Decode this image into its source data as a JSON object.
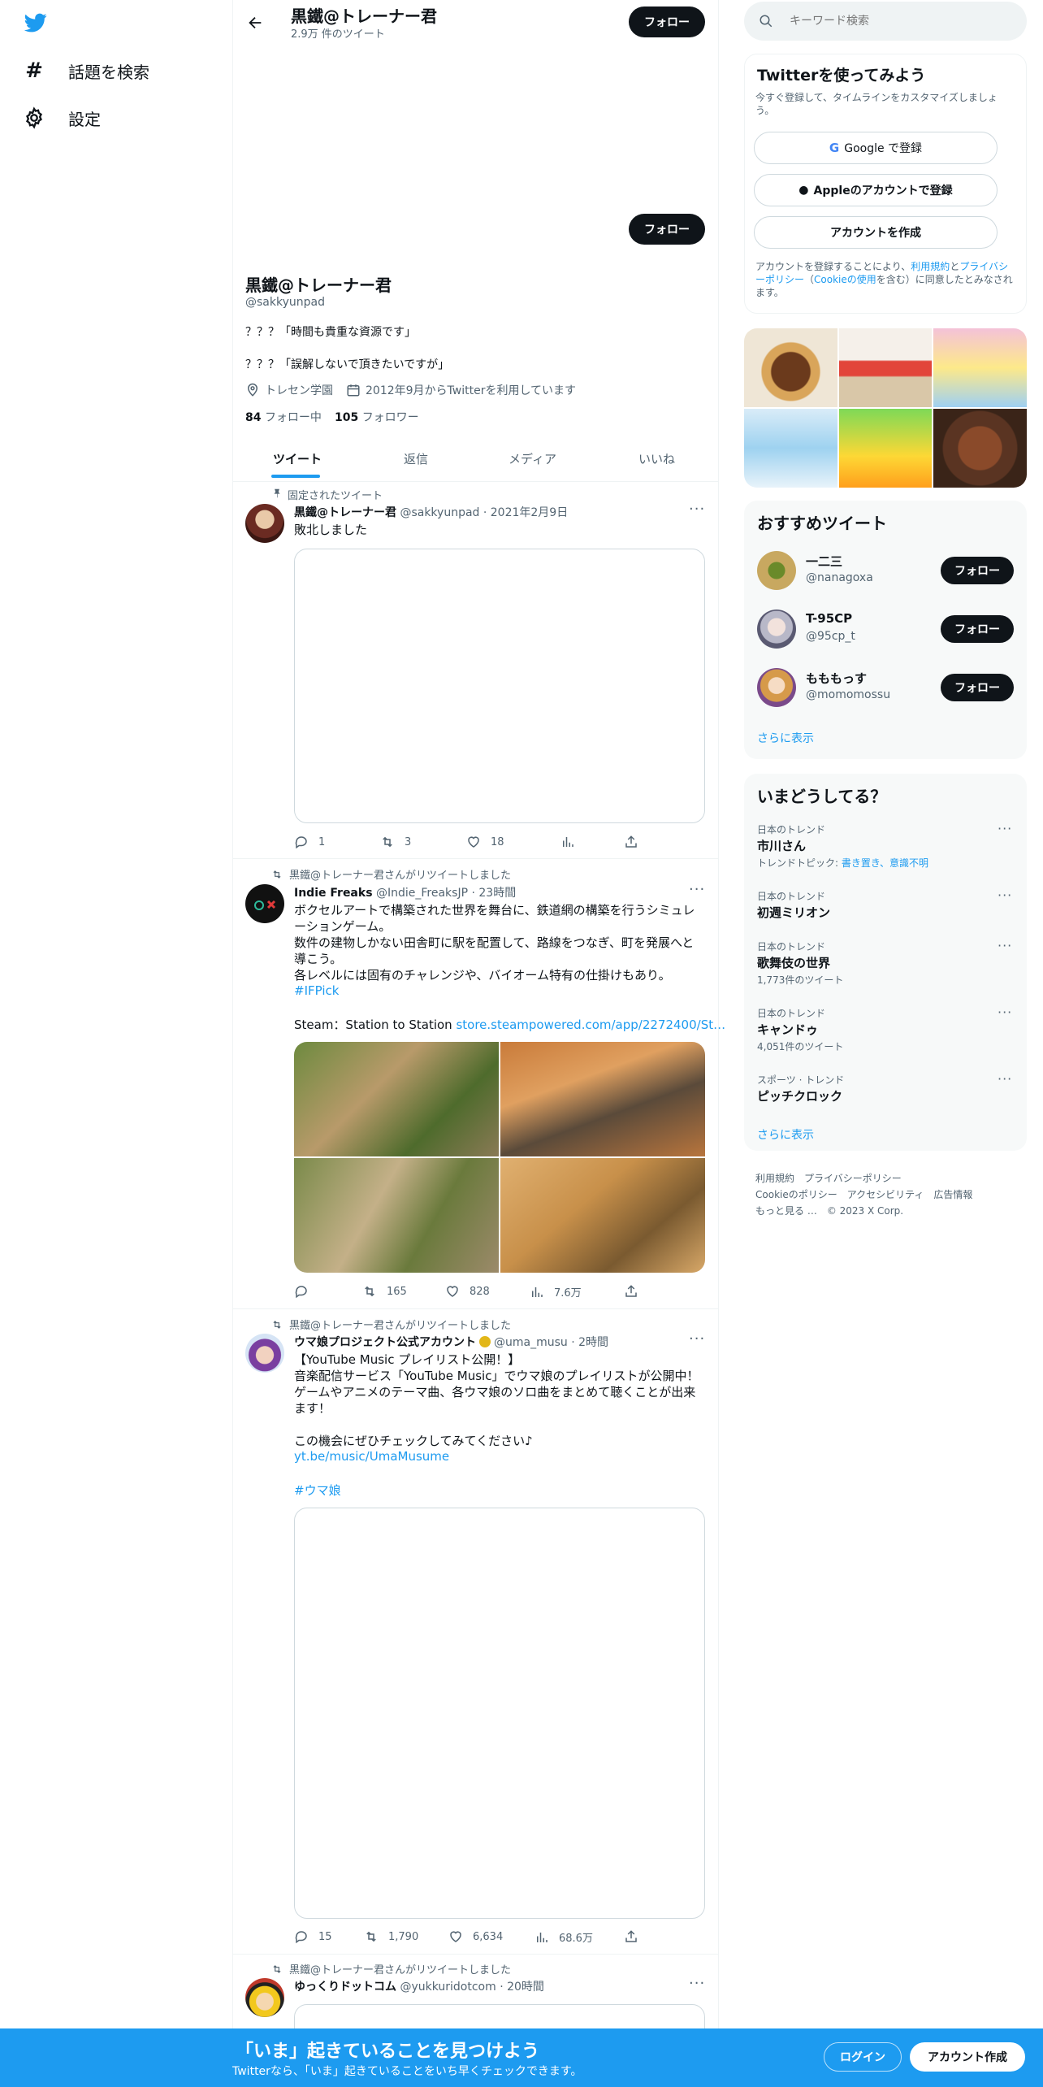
{
  "nav": {
    "explore_label": "話題を検索",
    "settings_label": "設定"
  },
  "header": {
    "name": "黒鐵@トレーナー君",
    "tweet_count": "2.9万 件のツイート",
    "follow_label": "フォロー"
  },
  "profile": {
    "follow_label": "フォロー",
    "name": "黒鐵@トレーナー君",
    "handle": "@sakkyunpad",
    "bio_line1": "？？？「時間も貴重な資源です」",
    "bio_line2": "？？？「誤解しないで頂きたいですが」",
    "location": "トレセン学園",
    "joined": "2012年9月からTwitterを利用しています",
    "following_count": "84",
    "following_label": "フォロー中",
    "followers_count": "105",
    "followers_label": "フォロワー"
  },
  "tabs": [
    "ツイート",
    "返信",
    "メディア",
    "いいね"
  ],
  "tweets": [
    {
      "context": "固定されたツイート",
      "name": "黒鐵@トレーナー君",
      "meta": "@sakkyunpad · 2021年2月9日",
      "text": "敗北しました",
      "replies": "1",
      "retweets": "3",
      "likes": "18",
      "views": ""
    },
    {
      "context": "黒鐵@トレーナー君さんがリツイートしました",
      "name": "Indie Freaks",
      "meta": "@Indie_FreaksJP · 23時間",
      "text": "ボクセルアートで構築された世界を舞台に、鉄道網の構築を行うシミュレーションゲーム。\n数件の建物しかない田舎町に駅を配置して、路線をつなぎ、町を発展へと導こう。\n各レベルには固有のチャレンジや、バイオーム特有の仕掛けもあり。",
      "hashtag": "#IFPick",
      "steam_prefix": "Steam：Station to Station ",
      "steam_link": "store.steampowered.com/app/2272400/St…",
      "replies": "",
      "retweets": "165",
      "likes": "828",
      "views": "7.6万"
    },
    {
      "context": "黒鐵@トレーナー君さんがリツイートしました",
      "name": "ウマ娘プロジェクト公式アカウント",
      "meta": "@uma_musu · 2時間",
      "text": "【YouTube Music プレイリスト公開！】\n音楽配信サービス「YouTube Music」でウマ娘のプレイリストが公開中！\nゲームやアニメのテーマ曲、各ウマ娘のソロ曲をまとめて聴くことが出来ます！\n\nこの機会にぜひチェックしてみてください♪",
      "link": "yt.be/music/UmaMusume",
      "hashtag": "#ウマ娘",
      "replies": "15",
      "retweets": "1,790",
      "likes": "6,634",
      "views": "68.6万"
    },
    {
      "context": "黒鐵@トレーナー君さんがリツイートしました",
      "name": "ゆっくりドットコム",
      "meta": "@yukkuridotcom · 20時間"
    }
  ],
  "search": {
    "placeholder": "キーワード検索"
  },
  "signup": {
    "title": "Twitterを使ってみよう",
    "subtitle": "今すぐ登録して、タイムラインをカスタマイズしましょう。",
    "google_label": "Google で登録",
    "apple_label": "Appleのアカウントで登録",
    "create_label": "アカウントを作成",
    "terms_prefix": "アカウントを登録することにより、",
    "terms_link": "利用規約",
    "terms_and": "と",
    "privacy_link": "プライバシーポリシー",
    "terms_paren_open": "（",
    "cookie_link": "Cookieの使用",
    "terms_suffix": "を含む）に同意したとみなされます。"
  },
  "recommend": {
    "title": "おすすめツイート",
    "users": [
      {
        "name": "一二三",
        "handle": "@nanagoxa",
        "button": "フォロー"
      },
      {
        "name": "T-95CP",
        "handle": "@95cp_t",
        "button": "フォロー"
      },
      {
        "name": "もももっす",
        "handle": "@momomossu",
        "button": "フォロー"
      }
    ],
    "more": "さらに表示"
  },
  "trends": {
    "title": "いまどうしてる？",
    "items": [
      {
        "category": "日本のトレンド",
        "name": "市川さん",
        "topic_prefix": "トレンドトピック: ",
        "topic": "書き置き、意識不明",
        "count": ""
      },
      {
        "category": "日本のトレンド",
        "name": "初週ミリオン",
        "count": ""
      },
      {
        "category": "日本のトレンド",
        "name": "歌舞伎の世界",
        "count": "1,773件のツイート"
      },
      {
        "category": "日本のトレンド",
        "name": "キャンドゥ",
        "count": "4,051件のツイート"
      },
      {
        "category": "スポーツ · トレンド",
        "name": "ピッチクロック",
        "count": ""
      }
    ],
    "more": "さらに表示"
  },
  "footer": {
    "links": [
      "利用規約",
      "プライバシーポリシー",
      "Cookieのポリシー",
      "アクセシビリティ",
      "広告情報",
      "もっと見る …"
    ],
    "copyright": "© 2023 X Corp."
  },
  "banner": {
    "title": "「いま」起きていることを見つけよう",
    "subtitle": "Twitterなら、「いま」起きていることをいち早くチェックできます。",
    "login_label": "ログイン",
    "signup_label": "アカウント作成"
  },
  "colors": {
    "accent": "#1d9bf0",
    "text": "#0f1419",
    "muted": "#536471",
    "banner": "#1d9bf0"
  }
}
